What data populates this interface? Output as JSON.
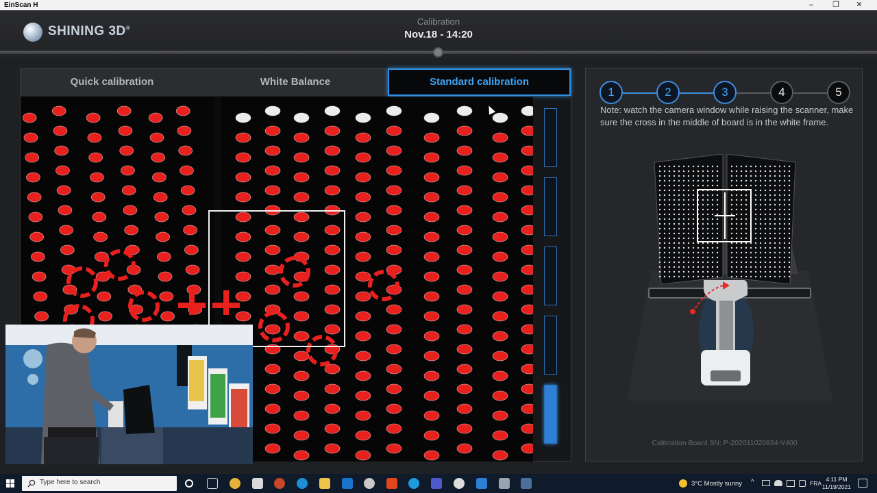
{
  "window": {
    "title": "EinScan H",
    "controls": {
      "minimize": "–",
      "maximize": "❐",
      "close": "✕"
    }
  },
  "header": {
    "brand": "SHINING 3D",
    "brand_mark": "®",
    "label": "Calibration",
    "datetime": "Nov.18 - 14:20"
  },
  "tabs": [
    {
      "label": "Quick calibration",
      "active": false
    },
    {
      "label": "White Balance",
      "active": false
    },
    {
      "label": "Standard calibration",
      "active": true
    }
  ],
  "distance_gauge": {
    "segments": 5,
    "active_segment": 5
  },
  "steps": [
    {
      "label": "1",
      "done": true
    },
    {
      "label": "2",
      "done": true
    },
    {
      "label": "3",
      "done": true
    },
    {
      "label": "4",
      "done": false
    },
    {
      "label": "5",
      "done": false
    }
  ],
  "note": "Note: watch the camera window while raising the scanner, make sure the cross in the middle of board is in the white frame.",
  "board_sn": "Calibration Board SN: P-202011020834-V400",
  "colors": {
    "accent": "#2f8fe0",
    "target_red": "#e8201e"
  },
  "taskbar": {
    "search_placeholder": "Type here to search",
    "weather": "3°C  Mostly sunny",
    "language": "FRA",
    "time": "4:11 PM",
    "date": "11/19/2021"
  }
}
